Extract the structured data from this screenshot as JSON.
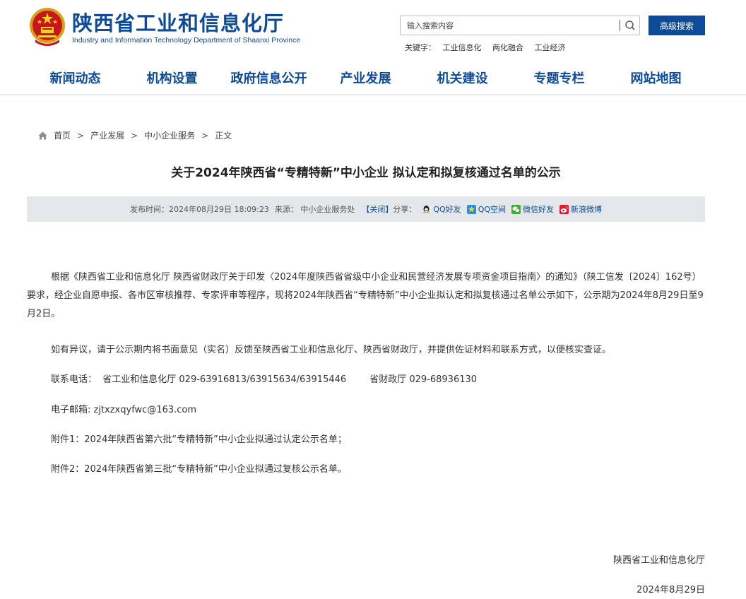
{
  "header": {
    "title": "陕西省工业和信息化厅",
    "subtitle": "Industry and Information Technology Department of Shaanxi Province",
    "search_placeholder": "输入搜索内容",
    "advanced_search_label": "高级搜索",
    "keywords_label": "关键字：",
    "keywords": [
      "工业信息化",
      "两化融合",
      "工业经济"
    ]
  },
  "nav": {
    "items": [
      "新闻动态",
      "机构设置",
      "政府信息公开",
      "产业发展",
      "机关建设",
      "专题专栏",
      "网站地图"
    ]
  },
  "breadcrumb": {
    "items": [
      "首页",
      "产业发展",
      "中小企业服务",
      "正文"
    ],
    "separator": ">"
  },
  "article": {
    "title": "关于2024年陕西省“专精特新”中小企业 拟认定和拟复核通过名单的公示",
    "publish_time": "发布时间：2024年08月29日 18:09:23",
    "source": "来源：  中小企业服务处",
    "close_label": "【关闭】",
    "share_label": "分享：",
    "share_items": [
      "QQ好友",
      "QQ空间",
      "微信好友",
      "新浪微博"
    ],
    "paragraphs": [
      "根据《陕西省工业和信息化厅  陕西省财政厅关于印发〈2024年度陕西省省级中小企业和民营经济发展专项资金项目指南〉的通知》（陕工信发〔2024〕162号）要求，经企业自愿申报、各市区审核推荐、专家评审等程序，现将2024年陕西省“专精特新”中小企业拟认定和拟复核通过名单公示如下，公示期为2024年8月29日至9月2日。",
      "如有异议，请于公示期内将书面意见（实名）反馈至陕西省工业和信息化厅、陕西省财政厅，并提供佐证材料和联系方式，以便核实查证。",
      "联系电话：  省工业和信息化厅 029-63916813/63915634/63915446        省财政厅 029-68936130",
      "电子邮箱: zjtxzxqyfwc@163.com",
      "附件1：2024年陕西省第六批“专精特新”中小企业拟通过认定公示名单；",
      "附件2：2024年陕西省第三批“专精特新”中小企业拟通过复核公示名单。"
    ],
    "signature": "陕西省工业和信息化厅",
    "date": "2024年8月29日"
  },
  "colors": {
    "brand": "#0d4a97",
    "meta_bar": "#e3e7ea"
  }
}
